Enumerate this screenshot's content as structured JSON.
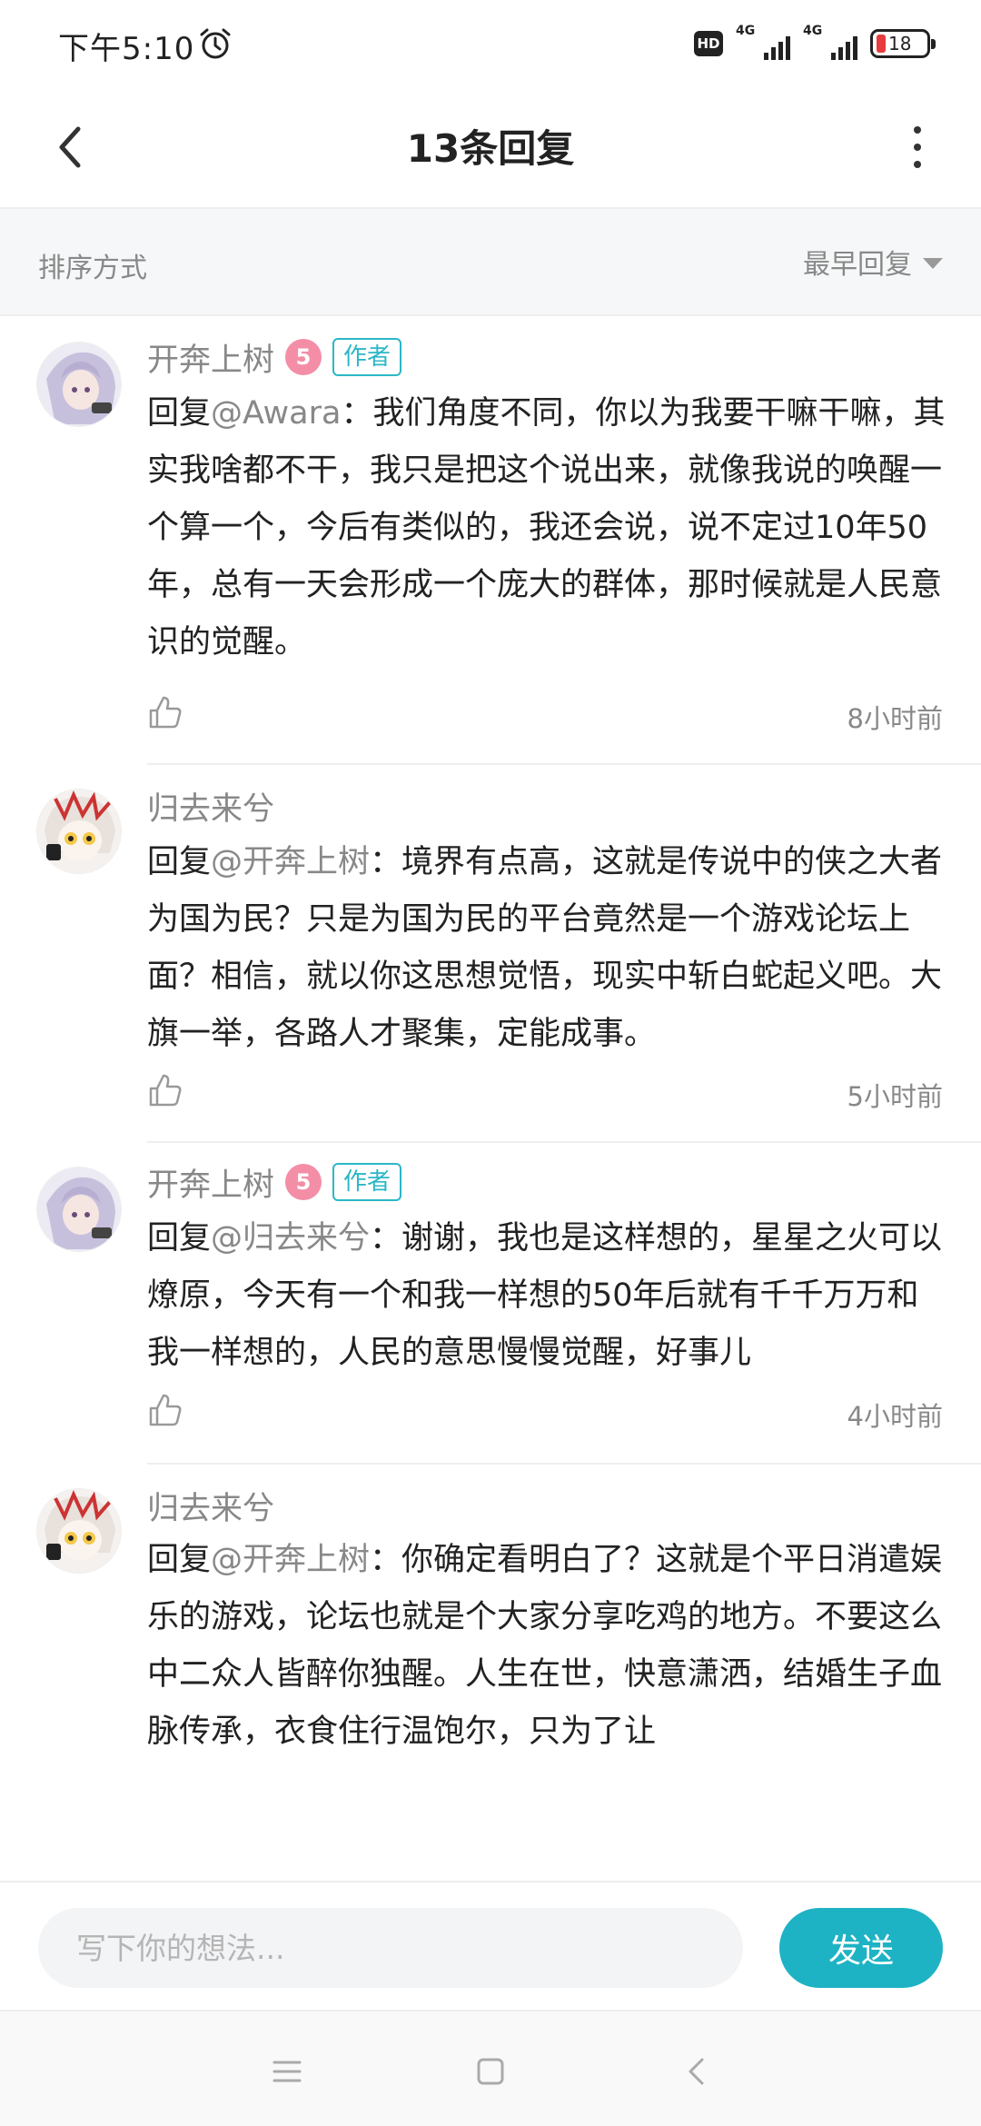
{
  "status": {
    "time": "下午5:10",
    "hd": "HD",
    "net1": "4G",
    "net2": "4G",
    "battery": "18"
  },
  "nav": {
    "title": "13条回复"
  },
  "sort": {
    "label": "排序方式",
    "value": "最早回复"
  },
  "replies": [
    {
      "author": "开奔上树",
      "level": "5",
      "tag": "作者",
      "prefix": "回复",
      "mention": "@Awara",
      "text": "：我们角度不同，你以为我要干嘛干嘛，其实我啥都不干，我只是把这个说出来，就像我说的唤醒一个算一个，今后有类似的，我还会说，说不定过10年50年，总有一天会形成一个庞大的群体，那时候就是人民意识的觉醒。",
      "time": "8小时前"
    },
    {
      "author": "归去来兮",
      "prefix": "回复",
      "mention": "@开奔上树",
      "text": "：境界有点高，这就是传说中的侠之大者为国为民？只是为国为民的平台竟然是一个游戏论坛上面？相信，就以你这思想觉悟，现实中斩白蛇起义吧。大旗一举，各路人才聚集，定能成事。",
      "time": "5小时前"
    },
    {
      "author": "开奔上树",
      "level": "5",
      "tag": "作者",
      "prefix": "回复",
      "mention": "@归去来兮",
      "text": "：谢谢，我也是这样想的，星星之火可以燎原，今天有一个和我一样想的50年后就有千千万万和我一样想的，人民的意思慢慢觉醒，好事儿",
      "time": "4小时前"
    },
    {
      "author": "归去来兮",
      "prefix": "回复",
      "mention": "@开奔上树",
      "text": "：你确定看明白了？这就是个平日消遣娱乐的游戏，论坛也就是个大家分享吃鸡的地方。不要这么中二众人皆醉你独醒。人生在世，快意潇洒，结婚生子血脉传承，衣食住行温饱尔，只为了让"
    }
  ],
  "composer": {
    "placeholder": "写下你的想法...",
    "send": "发送"
  },
  "colors": {
    "accent": "#1eb3c4",
    "level_badge": "#f38ea6",
    "muted_text": "#888888"
  }
}
